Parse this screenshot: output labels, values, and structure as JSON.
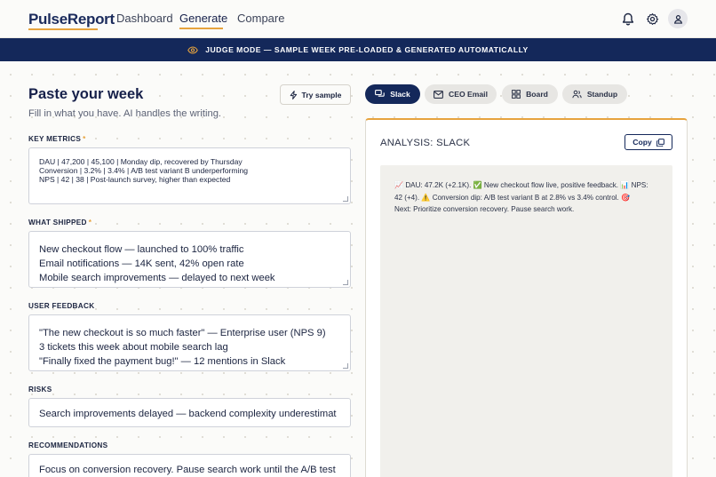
{
  "app": {
    "name": "PulseReport",
    "nav": [
      "Dashboard",
      "Generate",
      "Compare"
    ],
    "active_nav": "Generate"
  },
  "banner": {
    "text": "JUDGE MODE — SAMPLE WEEK PRE-LOADED & GENERATED AUTOMATICALLY",
    "icon": "eye-icon"
  },
  "input_panel": {
    "title": "Paste your week",
    "subtitle": "Fill in what you have. AI handles the writing.",
    "try_sample_label": "Try sample",
    "fields": {
      "key_metrics": {
        "label": "KEY METRICS",
        "required_mark": "*",
        "lines": [
          "DAU | 47,200 | 45,100 | Monday dip, recovered by Thursday",
          "Conversion | 3.2% | 3.4% | A/B test variant B underperforming",
          "NPS | 42 | 38 | Post-launch survey, higher than expected"
        ]
      },
      "what_shipped": {
        "label": "WHAT SHIPPED",
        "required_mark": "*",
        "lines": [
          "New checkout flow — launched to 100% traffic",
          "Email notifications — 14K sent, 42% open rate",
          "Mobile search improvements — delayed to next week"
        ]
      },
      "user_feedback": {
        "label": "USER FEEDBACK",
        "lines": [
          "\"The new checkout is so much faster\" — Enterprise user (NPS 9)",
          "3 tickets this week about mobile search lag",
          "\"Finally fixed the payment bug!\" — 12 mentions in Slack"
        ]
      },
      "risks": {
        "label": "RISKS",
        "lines": [
          "Search improvements delayed — backend complexity underestimat"
        ]
      },
      "recommendations": {
        "label": "RECOMMENDATIONS",
        "lines": [
          "Focus on conversion recovery. Pause search work until the A/B test"
        ]
      }
    }
  },
  "output_panel": {
    "tabs": [
      {
        "label": "Slack",
        "icon": "chat-icon",
        "active": true
      },
      {
        "label": "CEO Email",
        "icon": "mail-icon",
        "active": false
      },
      {
        "label": "Board",
        "icon": "grid-icon",
        "active": false
      },
      {
        "label": "Standup",
        "icon": "people-icon",
        "active": false
      }
    ],
    "title": "ANALYSIS: SLACK",
    "copy_label": "Copy",
    "output_lines": [
      "📈 DAU: 47.2K (+2.1K). ✅ New checkout flow live, positive feedback. 📊 NPS:",
      "42 (+4). ⚠️ Conversion dip: A/B test variant B at 2.8% vs 3.4% control. 🎯",
      "Next: Prioritize conversion recovery. Pause search work."
    ]
  },
  "colors": {
    "navy": "#14285a",
    "accent": "#e7a33e",
    "background": "#fbfbf9"
  }
}
